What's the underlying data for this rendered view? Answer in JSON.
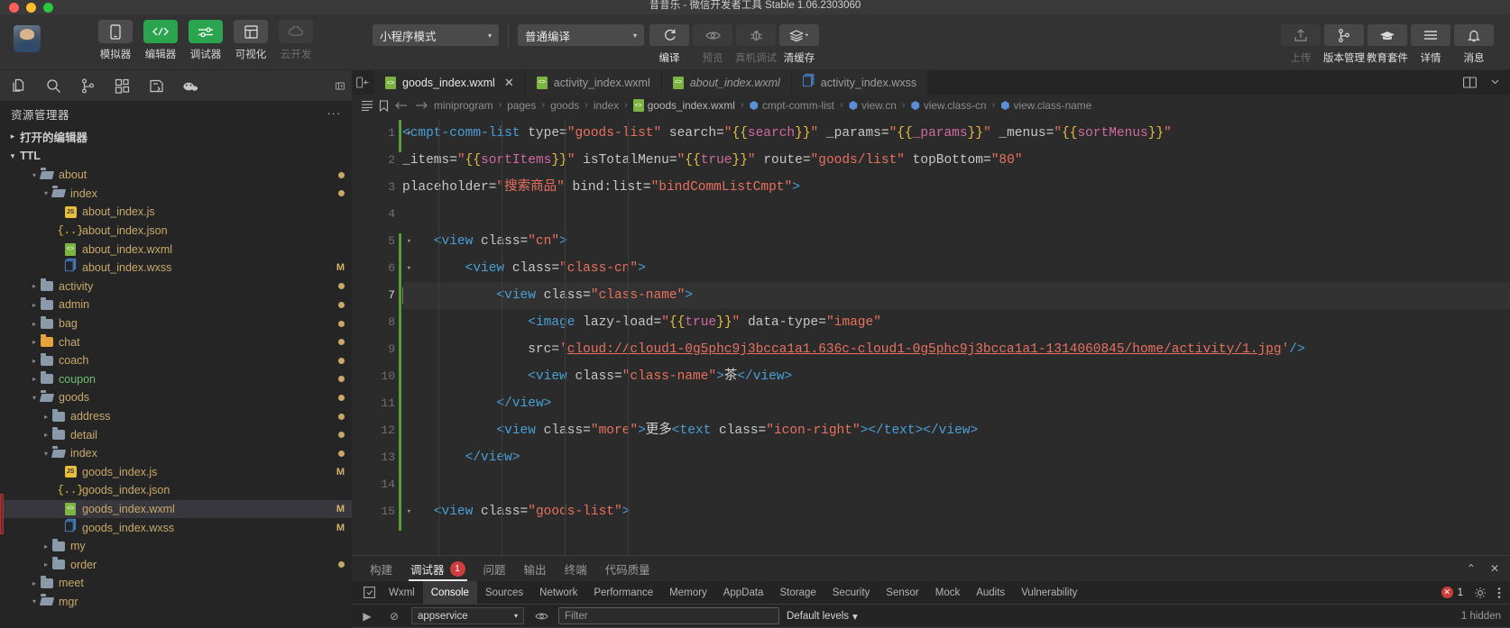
{
  "window": {
    "title": "昔昔乐 - 微信开发者工具 Stable 1.06.2303060"
  },
  "toolbar": {
    "left_buttons": [
      {
        "label": "模拟器",
        "icon": "phone-icon",
        "style": "grey"
      },
      {
        "label": "编辑器",
        "icon": "code-icon",
        "style": "green"
      },
      {
        "label": "调试器",
        "icon": "sliders-icon",
        "style": "green"
      },
      {
        "label": "可视化",
        "icon": "layout-icon",
        "style": "grey"
      },
      {
        "label": "云开发",
        "icon": "cloud-icon",
        "style": "disabled"
      }
    ],
    "mode_select": {
      "value": "小程序模式",
      "caret": "▾"
    },
    "compile_select": {
      "value": "普通编译",
      "caret": "▾"
    },
    "mid_buttons": [
      {
        "label": "编译",
        "icon": "refresh-icon",
        "state": "active"
      },
      {
        "label": "预览",
        "icon": "eye-icon",
        "state": "dim"
      },
      {
        "label": "真机调试",
        "icon": "bug-icon",
        "state": "dim"
      },
      {
        "label": "清缓存",
        "icon": "layers-icon",
        "state": "active"
      }
    ],
    "right_buttons": [
      {
        "label": "上传",
        "icon": "upload-icon",
        "state": "dim"
      },
      {
        "label": "版本管理",
        "icon": "branch-icon",
        "state": "active"
      },
      {
        "label": "教育套件",
        "icon": "graduation-icon",
        "state": "active"
      },
      {
        "label": "详情",
        "icon": "hamburger-icon",
        "state": "active"
      },
      {
        "label": "消息",
        "icon": "bell-icon",
        "state": "active"
      }
    ]
  },
  "activity_bar": {
    "icons": [
      "files-icon",
      "search-icon",
      "source-control-icon",
      "extensions-icon",
      "debug-icon",
      "miniprogram-icon"
    ],
    "collapse": "collapse-icon"
  },
  "explorer": {
    "title": "资源管理器",
    "more": "···",
    "sections": [
      {
        "label": "打开的编辑器",
        "twisty": "▸"
      },
      {
        "label": "TTL",
        "twisty": "▾"
      }
    ],
    "tree": [
      {
        "name": "about",
        "type": "folder-open",
        "depth": 2,
        "twisty": "▾",
        "dirty": true
      },
      {
        "name": "index",
        "type": "folder-open",
        "depth": 3,
        "twisty": "▾",
        "dirty": true
      },
      {
        "name": "about_index.js",
        "type": "js",
        "depth": 4,
        "twisty": "",
        "dirty": false
      },
      {
        "name": "about_index.json",
        "type": "json",
        "depth": 4,
        "twisty": "",
        "dirty": false
      },
      {
        "name": "about_index.wxml",
        "type": "wxml",
        "depth": 4,
        "twisty": "",
        "dirty": false
      },
      {
        "name": "about_index.wxss",
        "type": "wxss",
        "depth": 4,
        "twisty": "",
        "mark": "M"
      },
      {
        "name": "activity",
        "type": "folder",
        "depth": 2,
        "twisty": "▸",
        "dirty": true
      },
      {
        "name": "admin",
        "type": "folder",
        "depth": 2,
        "twisty": "▸",
        "dirty": true
      },
      {
        "name": "bag",
        "type": "folder",
        "depth": 2,
        "twisty": "▸",
        "dirty": true
      },
      {
        "name": "chat",
        "type": "folder-orange",
        "depth": 2,
        "twisty": "▸",
        "dirty": true
      },
      {
        "name": "coach",
        "type": "folder",
        "depth": 2,
        "twisty": "▸",
        "dirty": true
      },
      {
        "name": "coupon",
        "type": "folder",
        "depth": 2,
        "twisty": "▸",
        "dirty": true,
        "green": true
      },
      {
        "name": "goods",
        "type": "folder-open",
        "depth": 2,
        "twisty": "▾",
        "dirty": true
      },
      {
        "name": "address",
        "type": "folder",
        "depth": 3,
        "twisty": "▸",
        "dirty": true
      },
      {
        "name": "detail",
        "type": "folder",
        "depth": 3,
        "twisty": "▸",
        "dirty": true
      },
      {
        "name": "index",
        "type": "folder-open",
        "depth": 3,
        "twisty": "▾",
        "dirty": true
      },
      {
        "name": "goods_index.js",
        "type": "js",
        "depth": 4,
        "twisty": "",
        "mark": "M"
      },
      {
        "name": "goods_index.json",
        "type": "json",
        "depth": 4,
        "twisty": "",
        "dirty": false
      },
      {
        "name": "goods_index.wxml",
        "type": "wxml",
        "depth": 4,
        "twisty": "",
        "mark": "M",
        "selected": true
      },
      {
        "name": "goods_index.wxss",
        "type": "wxss",
        "depth": 4,
        "twisty": "",
        "mark": "M"
      },
      {
        "name": "my",
        "type": "folder",
        "depth": 3,
        "twisty": "▸",
        "dirty": false
      },
      {
        "name": "order",
        "type": "folder",
        "depth": 3,
        "twisty": "▸",
        "dirty": true
      },
      {
        "name": "meet",
        "type": "folder",
        "depth": 2,
        "twisty": "▸",
        "dirty": false
      },
      {
        "name": "mgr",
        "type": "folder-open",
        "depth": 2,
        "twisty": "▾",
        "dirty": false
      }
    ]
  },
  "editor": {
    "tabs": [
      {
        "label": "goods_index.wxml",
        "icon": "wxml-icon",
        "active": true,
        "italic": false,
        "close": "✕"
      },
      {
        "label": "activity_index.wxml",
        "icon": "wxml-icon",
        "active": false,
        "italic": false,
        "close": ""
      },
      {
        "label": "about_index.wxml",
        "icon": "wxml-icon",
        "active": false,
        "italic": true,
        "close": ""
      },
      {
        "label": "activity_index.wxss",
        "icon": "wxss-icon",
        "active": false,
        "italic": false,
        "close": ""
      }
    ],
    "tab_actions": [
      "split-editor-icon",
      "more-actions-icon"
    ],
    "breadcrumb_icons": [
      "outline-icon",
      "bookmark-icon",
      "back-arrow-icon",
      "forward-arrow-icon"
    ],
    "breadcrumb": [
      {
        "label": "miniprogram",
        "icon": ""
      },
      {
        "label": "pages",
        "icon": ""
      },
      {
        "label": "goods",
        "icon": ""
      },
      {
        "label": "index",
        "icon": ""
      },
      {
        "label": "goods_index.wxml",
        "icon": "wxml-icon"
      },
      {
        "label": "cmpt-comm-list",
        "icon": "cube-icon"
      },
      {
        "label": "view.cn",
        "icon": "cube-icon"
      },
      {
        "label": "view.class-cn",
        "icon": "cube-icon"
      },
      {
        "label": "view.class-name",
        "icon": "cube-icon"
      }
    ],
    "breadcrumb_sep": "›",
    "current_line": 7,
    "lines": [
      {
        "n": 1,
        "fold": "▾",
        "text": "<cmpt-comm-list type=\"goods-list\" search=\"{{search}}\" _params=\"{{_params}}\" _menus=\"{{sortMenus}}\""
      },
      {
        "n": 2,
        "fold": "",
        "text": "_items=\"{{sortItems}}\" isTotalMenu=\"{{true}}\" route=\"goods/list\" topBottom=\"80\""
      },
      {
        "n": 3,
        "fold": "",
        "text": "placeholder=\"搜索商品\" bind:list=\"bindCommListCmpt\">"
      },
      {
        "n": 4,
        "fold": "",
        "text": ""
      },
      {
        "n": 5,
        "fold": "▾",
        "text": "    <view class=\"cn\">"
      },
      {
        "n": 6,
        "fold": "▾",
        "text": "        <view class=\"class-cn\">"
      },
      {
        "n": 7,
        "fold": "▾",
        "text": "            <view class=\"class-name\">"
      },
      {
        "n": 8,
        "fold": "",
        "text": "                <image lazy-load=\"{{true}}\" data-type=\"image\""
      },
      {
        "n": 9,
        "fold": "",
        "text": "                src='cloud://cloud1-0g5phc9j3bcca1a1.636c-cloud1-0g5phc9j3bcca1a1-1314060845/home/activity/1.jpg'/>"
      },
      {
        "n": 10,
        "fold": "",
        "text": "                <view class=\"class-name\">茶</view>"
      },
      {
        "n": 11,
        "fold": "",
        "text": "            </view>"
      },
      {
        "n": 12,
        "fold": "",
        "text": "            <view class=\"more\">更多<text class=\"icon-right\"></text></view>"
      },
      {
        "n": 13,
        "fold": "",
        "text": "        </view>"
      },
      {
        "n": 14,
        "fold": "",
        "text": ""
      },
      {
        "n": 15,
        "fold": "▾",
        "text": "    <view class=\"goods-list\">"
      }
    ]
  },
  "panel": {
    "tabs": [
      {
        "label": "构建",
        "active": false,
        "badge": ""
      },
      {
        "label": "调试器",
        "active": true,
        "badge": "1"
      },
      {
        "label": "问题",
        "active": false,
        "badge": ""
      },
      {
        "label": "输出",
        "active": false,
        "badge": ""
      },
      {
        "label": "终端",
        "active": false,
        "badge": ""
      },
      {
        "label": "代码质量",
        "active": false,
        "badge": ""
      }
    ],
    "maximize": "⌃",
    "close": "✕"
  },
  "devtools": {
    "inspect_icon": "inspect-icon",
    "tabs": [
      {
        "label": "Wxml",
        "active": false
      },
      {
        "label": "Console",
        "active": true
      },
      {
        "label": "Sources",
        "active": false
      },
      {
        "label": "Network",
        "active": false
      },
      {
        "label": "Performance",
        "active": false
      },
      {
        "label": "Memory",
        "active": false
      },
      {
        "label": "AppData",
        "active": false
      },
      {
        "label": "Storage",
        "active": false
      },
      {
        "label": "Security",
        "active": false
      },
      {
        "label": "Sensor",
        "active": false
      },
      {
        "label": "Mock",
        "active": false
      },
      {
        "label": "Audits",
        "active": false
      },
      {
        "label": "Vulnerability",
        "active": false
      }
    ],
    "error_count": "1",
    "settings_icon": "gear-icon",
    "more_icon": "kebab-icon",
    "console": {
      "run_icon": "▶",
      "clear_icon": "⊘",
      "context": "appservice",
      "context_caret": "▾",
      "eye_icon": "eye-icon",
      "filter_placeholder": "Filter",
      "levels": "Default levels",
      "levels_caret": "▾",
      "hidden": "1 hidden"
    }
  },
  "colors": {
    "accent_green": "#2aa44f",
    "error_red": "#cf3c3c",
    "tag": "#4a9fd8",
    "string": "#e8705f",
    "brace": "#e8bf3d",
    "binding": "#cf6a9e"
  }
}
